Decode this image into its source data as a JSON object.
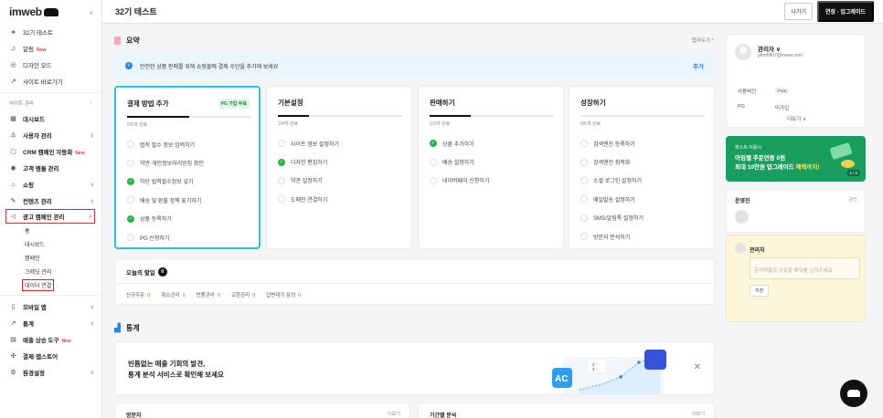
{
  "sidebar": {
    "logo": "imweb",
    "site_name": "32기 테스트",
    "top_items": [
      {
        "label": "알림",
        "badge": "New",
        "icon": "bell-icon"
      },
      {
        "label": "디자인 모드",
        "icon": "palette-icon"
      },
      {
        "label": "사이트 바로가기",
        "icon": "external-link-icon"
      }
    ],
    "section_label": "사이트 관리",
    "items": [
      {
        "label": "대시보드",
        "icon": "grid-icon"
      },
      {
        "label": "사용자 관리",
        "icon": "user-icon"
      },
      {
        "label": "CRM 캠페인 자동화",
        "badge": "New",
        "icon": "crm-icon"
      },
      {
        "label": "고객 멤돌 관리",
        "icon": "target-icon"
      },
      {
        "label": "쇼핑",
        "icon": "bag-icon"
      },
      {
        "label": "컨텐츠 관리",
        "icon": "edit-icon"
      },
      {
        "label": "광고 캠페인 관리",
        "icon": "megaphone-icon"
      }
    ],
    "ad_sub_items": [
      "홈",
      "대시보드",
      "캠페인",
      "크레딧 관리",
      "데이터 연결"
    ],
    "bottom_items": [
      {
        "label": "모바일 앱",
        "icon": "mobile-icon"
      },
      {
        "label": "통계",
        "icon": "chart-icon"
      },
      {
        "label": "매출 상승 도구",
        "badge": "New",
        "icon": "tools-icon"
      },
      {
        "label": "결제·앱스토어",
        "icon": "store-icon"
      },
      {
        "label": "환경설정",
        "icon": "gear-icon"
      }
    ]
  },
  "topbar": {
    "title": "32기 테스트",
    "exit_label": "나가기",
    "upgrade_label": "연장 · 업그레이드"
  },
  "summary": {
    "title": "요약",
    "collapse_label": "접어두기 ^",
    "notice_text": "안전한 상품 판매를 위해 쇼핑몰에 결제 수단을 추가해 보세요",
    "notice_action": "추가",
    "cards": [
      {
        "title": "결제 방법 추가",
        "tag": "PG 가입 무료",
        "progress": 0.5,
        "count": "2/6개 완료",
        "items": [
          {
            "label": "법적 필수 정보 입력하기",
            "done": false
          },
          {
            "label": "약관·개인정보처리방침 확인",
            "done": false
          },
          {
            "label": "하단 법적필수정보 넣기",
            "done": true
          },
          {
            "label": "배송 및 환불 정책 표기하기",
            "done": false
          },
          {
            "label": "상품 등록하기",
            "done": true
          },
          {
            "label": "PG 신청하기",
            "done": false
          }
        ]
      },
      {
        "title": "기본설정",
        "tag": "",
        "progress": 0.25,
        "count": "1/4개 완료",
        "items": [
          {
            "label": "사이트 정보 설정하기",
            "done": false
          },
          {
            "label": "디자인 편집하기",
            "done": true
          },
          {
            "label": "약관 설정하기",
            "done": false
          },
          {
            "label": "도메인 연결하기",
            "done": false
          }
        ]
      },
      {
        "title": "판매하기",
        "tag": "",
        "progress": 0.33,
        "count": "1/3개 완료",
        "items": [
          {
            "label": "상품 추가하기",
            "done": true
          },
          {
            "label": "배송 설정하기",
            "done": false
          },
          {
            "label": "네이버페이 신청하기",
            "done": false
          }
        ]
      },
      {
        "title": "성장하기",
        "tag": "",
        "progress": 0,
        "count": "0/6개 완료",
        "items": [
          {
            "label": "검색엔진 등록하기",
            "done": false
          },
          {
            "label": "검색엔진 최적화",
            "done": false
          },
          {
            "label": "소셜 로그인 설정하기",
            "done": false
          },
          {
            "label": "메일발송 설정하기",
            "done": false
          },
          {
            "label": "SMS/알림톡 설정하기",
            "done": false
          },
          {
            "label": "방문자 분석하기",
            "done": false
          }
        ]
      }
    ]
  },
  "todo": {
    "title": "오늘의 할일",
    "count": "0",
    "stats": [
      {
        "label": "신규주문",
        "value": "0"
      },
      {
        "label": "취소관리",
        "value": "0"
      },
      {
        "label": "반품관리",
        "value": "0"
      },
      {
        "label": "교환관리",
        "value": "0"
      },
      {
        "label": "답변대기 문의",
        "value": "0"
      }
    ]
  },
  "stats": {
    "title": "통계",
    "banner_line1": "빈틈없는 매출 기회의 발견,",
    "banner_line2": "통계 분석 서비스로 확인해 보세요",
    "graph_values": [
      "2",
      "3"
    ],
    "bottom_cards": [
      {
        "title": "방문자",
        "more": "더보기"
      },
      {
        "title": "기간별 분석",
        "more": "더보기"
      }
    ]
  },
  "profile": {
    "name": "관리자 ∨",
    "email": "phm6807@naver.com",
    "plan_label": "사용버전",
    "plan_value": "Free",
    "pg_label": "PG",
    "pg_value": "미가입",
    "more_label": "더보기 ∨"
  },
  "ad_banner": {
    "line1": "퍼스트 이용시",
    "line2": "아임웹 주문연동 0원",
    "line3_prefix": "최대 10만원 업그레이드 ",
    "line3_highlight": "혜택까지!",
    "pager": "4 / 6"
  },
  "operators": {
    "title": "운영진",
    "manage": "관리"
  },
  "memo": {
    "name": "관리자",
    "placeholder": "관리자들과 공유할 메모를 남겨주세요",
    "save_label": "저장"
  },
  "colors": {
    "accent": "#2cc0e3",
    "done": "#27b24a",
    "highlight_box": "#d7282f"
  }
}
